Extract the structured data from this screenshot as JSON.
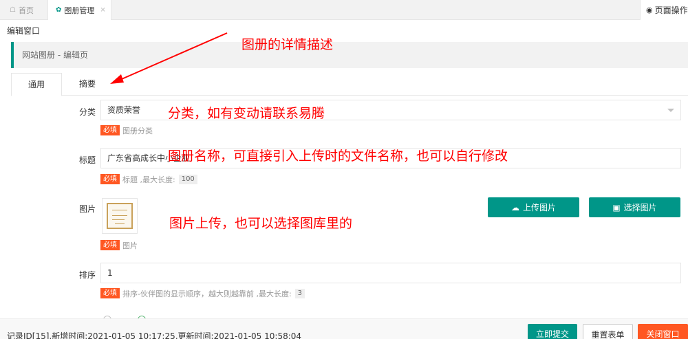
{
  "tabs": {
    "home_label": "首页",
    "album_label": "图册管理",
    "close_glyph": "×",
    "page_ops_label": "页面操作"
  },
  "window": {
    "title": "编辑窗口"
  },
  "breadcrumb": {
    "text": "网站图册 - 编辑页"
  },
  "form_tabs": {
    "general": "通用",
    "summary": "摘要"
  },
  "fields": {
    "category": {
      "label": "分类",
      "value": "资质荣誉",
      "required": "必填",
      "hint": "图册分类"
    },
    "title": {
      "label": "标题",
      "value": "广东省高成长中小企业",
      "required": "必填",
      "hint": "标题 ,最大长度:",
      "max": "100"
    },
    "image": {
      "label": "图片",
      "required": "必填",
      "hint": "图片",
      "upload_label": "上传图片",
      "choose_label": "选择图片"
    },
    "sort": {
      "label": "排序",
      "value": "1",
      "required": "必填",
      "hint": "排序-伙伴图的显示顺序，越大则越靠前 ,最大长度:",
      "max": "3"
    }
  },
  "footer": {
    "record": "记录ID[15],新增时间:2021-01-05 10:17:25,更新时间:2021-01-05 10:58:04",
    "submit": "立即提交",
    "reset": "重置表单",
    "close": "关闭窗口"
  },
  "annotations": {
    "summary_note": "图册的详情描述",
    "category_note": "分类，如有变动请联系易腾",
    "title_note": "图册名称，可直接引入上传时的文件名称，也可以自行修改",
    "image_note": "图片上传，也可以选择图库里的"
  },
  "colors": {
    "accent": "#009688",
    "danger": "#ff5722",
    "annotation": "#ff0000"
  },
  "icons": {
    "home": "home-icon",
    "album": "gear-icon",
    "ops": "target-icon",
    "upload": "cloud-upload-icon",
    "choose": "image-icon"
  }
}
